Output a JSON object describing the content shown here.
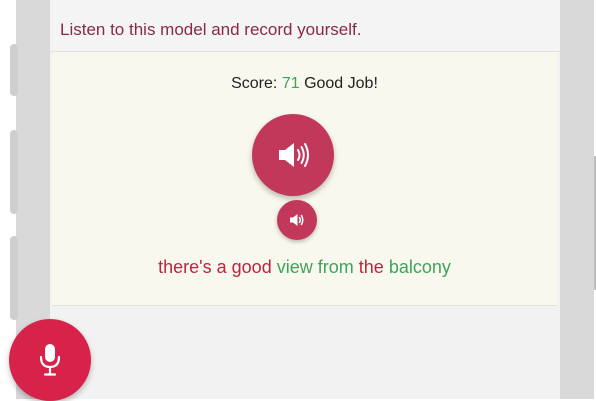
{
  "header": {
    "instruction": "Listen to this model and record yourself."
  },
  "result": {
    "score_label": "Score:",
    "score_value": "71",
    "feedback": "Good Job!"
  },
  "sentence": {
    "words": [
      {
        "text": "there's",
        "status": "incorrect"
      },
      {
        "text": "a",
        "status": "incorrect"
      },
      {
        "text": "good",
        "status": "incorrect"
      },
      {
        "text": "view",
        "status": "correct"
      },
      {
        "text": "from",
        "status": "correct"
      },
      {
        "text": "the",
        "status": "incorrect"
      },
      {
        "text": "balcony",
        "status": "correct"
      }
    ]
  },
  "colors": {
    "correct": "#3ea35c",
    "incorrect": "#b9263f",
    "accent": "#c1385a",
    "record": "#d7234a",
    "header_text": "#8a2a45"
  },
  "icons": {
    "play_model": "speaker-icon",
    "play_recording": "speaker-icon",
    "record": "microphone-icon"
  }
}
